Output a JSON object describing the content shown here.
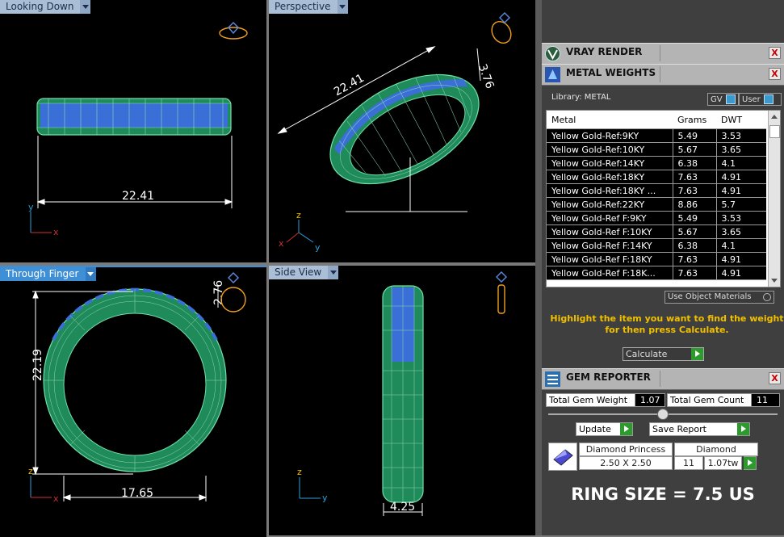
{
  "viewports": {
    "top_left": {
      "label": "Looking Down",
      "dim": "22.41",
      "axes": {
        "y": "y",
        "x": "x"
      }
    },
    "top_right": {
      "label": "Perspective",
      "dim_length": "22.41",
      "dim_side": "3.76",
      "axes": {
        "z": "z",
        "x": "x",
        "y": "y"
      }
    },
    "bottom_left": {
      "label": "Through Finger",
      "dim_height": "22.19",
      "dim_width": "17.65",
      "dim_thickness": "2.76",
      "axes": {
        "z": "z",
        "x": "x"
      }
    },
    "bottom_right": {
      "label": "Side View",
      "dim": "4.25",
      "axes": {
        "z": "z",
        "y": "y"
      }
    }
  },
  "panel": {
    "vray": {
      "title": "VRAY RENDER",
      "close": "X"
    },
    "metal": {
      "title": "METAL WEIGHTS",
      "close": "X",
      "library_label": "Library: METAL",
      "gv_label": "GV",
      "user_label": "User",
      "columns": [
        "Metal",
        "Grams",
        "DWT"
      ],
      "rows": [
        [
          "Yellow Gold-Ref:9KY",
          "5.49",
          "3.53"
        ],
        [
          "Yellow Gold-Ref:10KY",
          "5.67",
          "3.65"
        ],
        [
          "Yellow Gold-Ref:14KY",
          "6.38",
          "4.1"
        ],
        [
          "Yellow Gold-Ref:18KY",
          "7.63",
          "4.91"
        ],
        [
          "Yellow Gold-Ref:18KY ...",
          "7.63",
          "4.91"
        ],
        [
          "Yellow Gold-Ref:22KY",
          "8.86",
          "5.7"
        ],
        [
          "Yellow Gold-Ref F:9KY",
          "5.49",
          "3.53"
        ],
        [
          "Yellow Gold-Ref F:10KY",
          "5.67",
          "3.65"
        ],
        [
          "Yellow Gold-Ref F:14KY",
          "6.38",
          "4.1"
        ],
        [
          "Yellow Gold-Ref F:18KY",
          "7.63",
          "4.91"
        ],
        [
          "Yellow Gold-Ref F:18K...",
          "7.63",
          "4.91"
        ]
      ],
      "use_object_materials": "Use Object Materials",
      "hint": "Highlight the item you want to find the weight for then press Calculate.",
      "calculate_label": "Calculate"
    },
    "gem": {
      "title": "GEM REPORTER",
      "close": "X",
      "total_weight_label": "Total Gem Weight",
      "total_weight_value": "1.07",
      "total_count_label": "Total Gem Count",
      "total_count_value": "11",
      "update_label": "Update",
      "save_label": "Save Report",
      "gem_name": "Diamond Princess",
      "gem_size": "2.50 X 2.50",
      "gem_type": "Diamond",
      "gem_count": "11",
      "gem_weight": "1.07tw"
    },
    "ring_size": "RING SIZE = 7.5 US"
  },
  "colors": {
    "ring_green": "#1f8a5a",
    "stone_blue": "#3b6fd8",
    "tab_active": "#3e8fd6",
    "hint_yellow": "#f0c000"
  }
}
